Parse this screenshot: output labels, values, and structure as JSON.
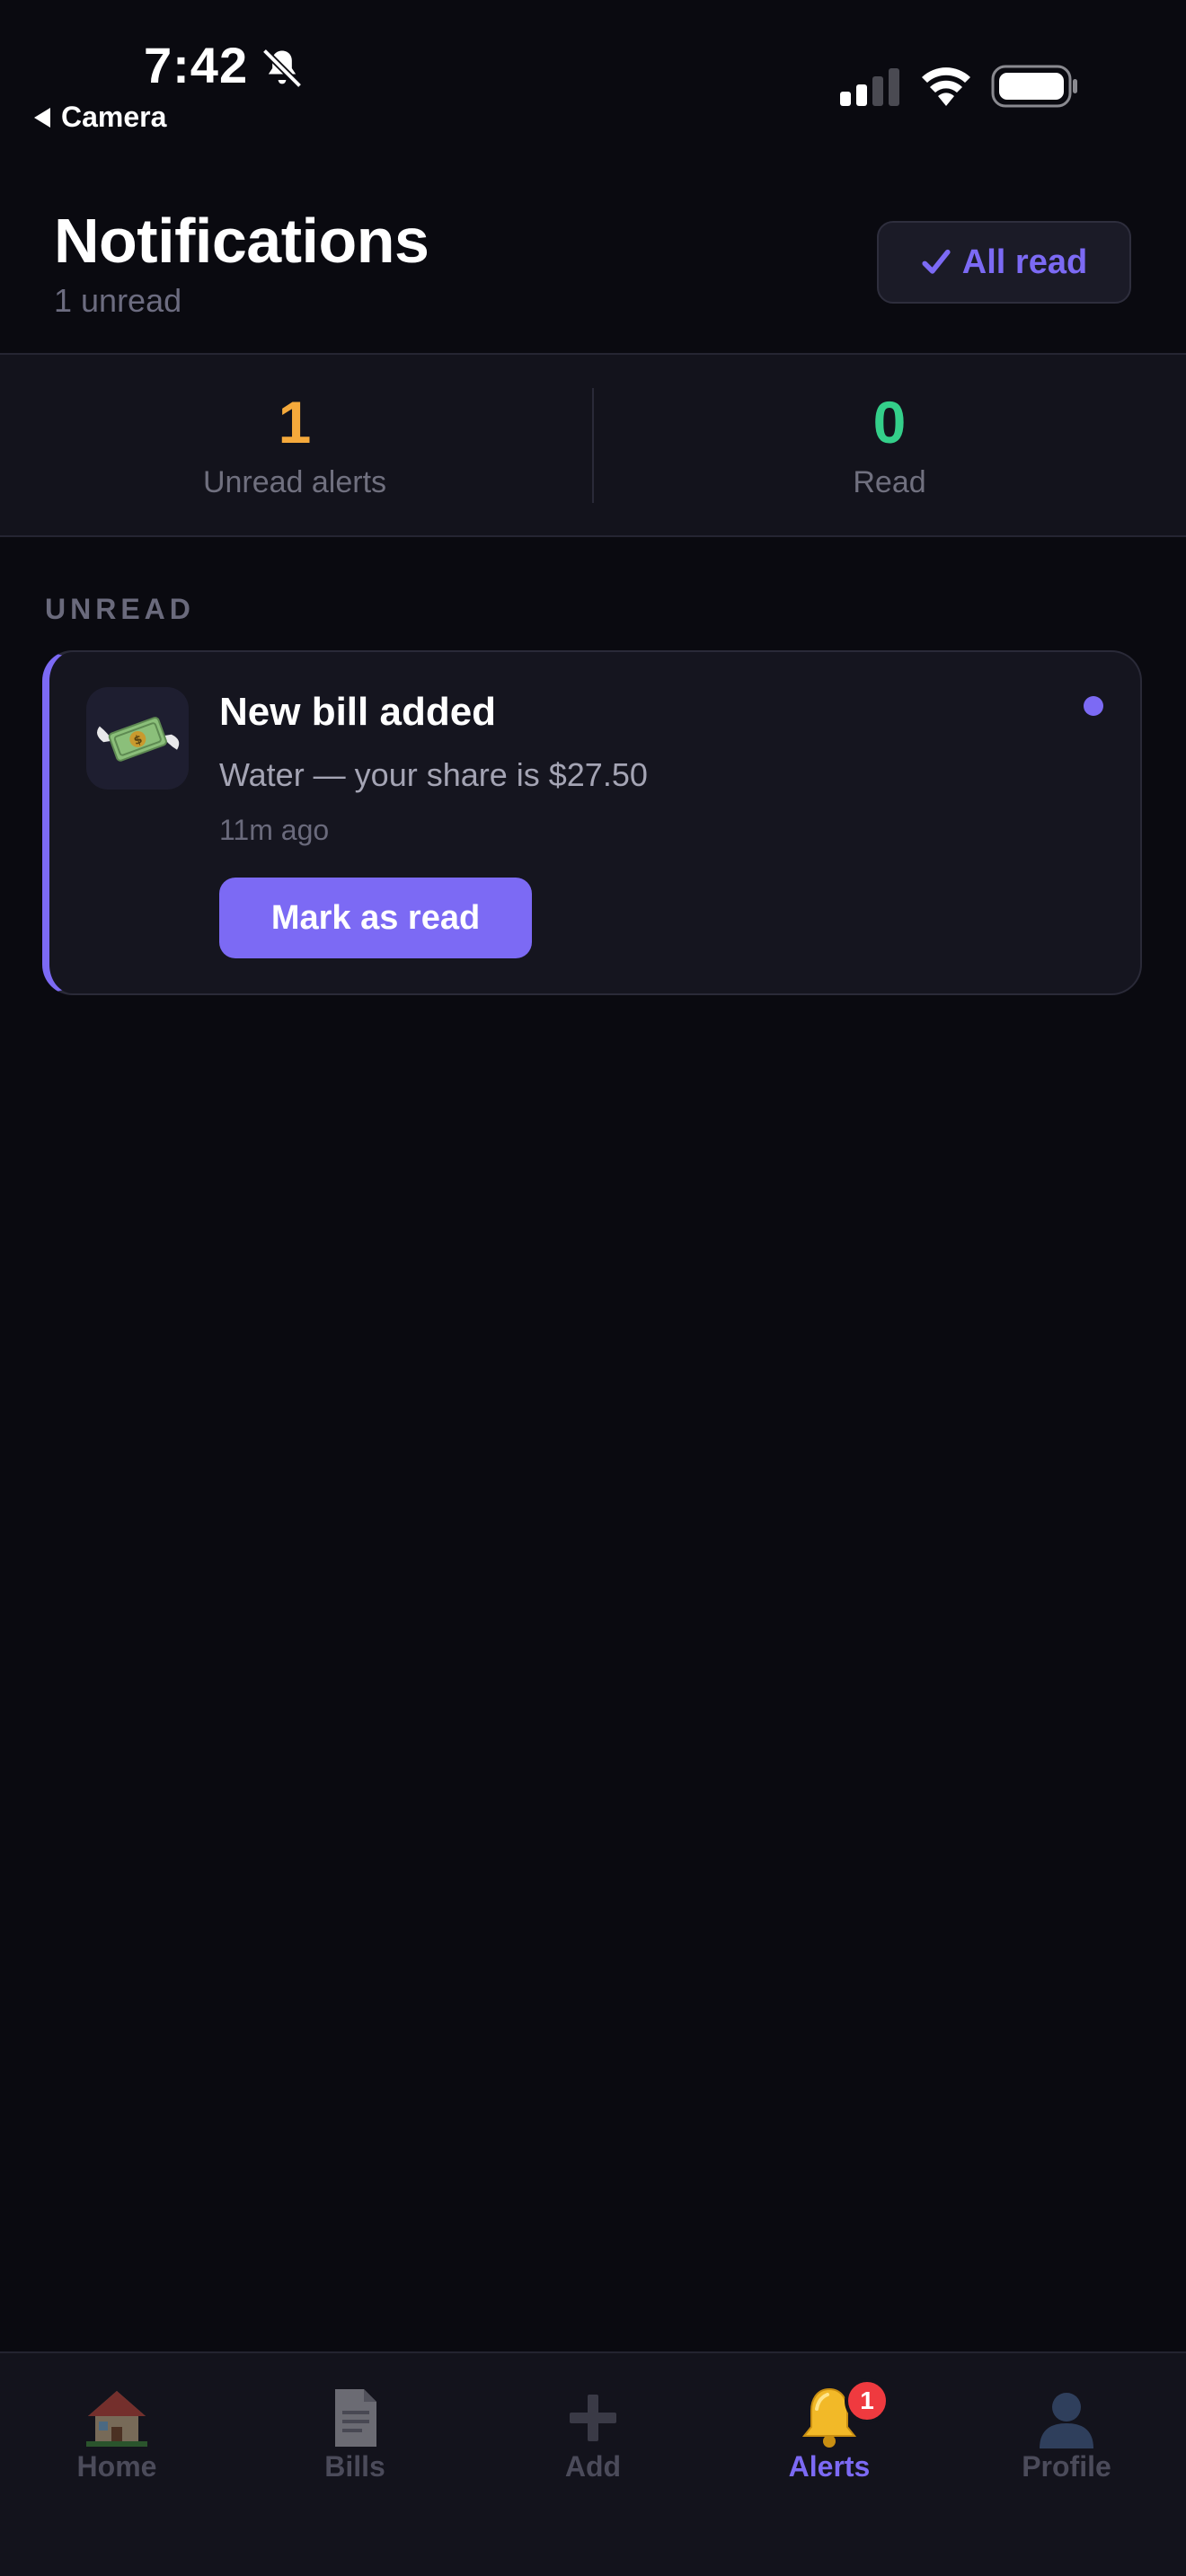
{
  "status_bar": {
    "time": "7:42",
    "back_label": "Camera"
  },
  "header": {
    "title": "Notifications",
    "subtitle": "1 unread",
    "all_read_label": "All read"
  },
  "stats": [
    {
      "value": "1",
      "label": "Unread alerts",
      "color": "#f5a93b"
    },
    {
      "value": "0",
      "label": "Read",
      "color": "#34cf8a"
    }
  ],
  "section": {
    "label": "UNREAD"
  },
  "notifications": [
    {
      "title": "New bill added",
      "body": "Water — your share is $27.50",
      "time": "11m ago",
      "action_label": "Mark as read",
      "icon": "money-with-wings-icon"
    }
  ],
  "tabs": [
    {
      "label": "Home",
      "icon": "house-icon"
    },
    {
      "label": "Bills",
      "icon": "document-icon"
    },
    {
      "label": "Add",
      "icon": "plus-icon"
    },
    {
      "label": "Alerts",
      "icon": "bell-icon",
      "badge": "1"
    },
    {
      "label": "Profile",
      "icon": "person-icon"
    }
  ],
  "colors": {
    "accent": "#7c6af4",
    "background": "#0a0a10",
    "unread_count": "#f5a93b",
    "read_count": "#34cf8a",
    "badge": "#ef3a3f"
  }
}
